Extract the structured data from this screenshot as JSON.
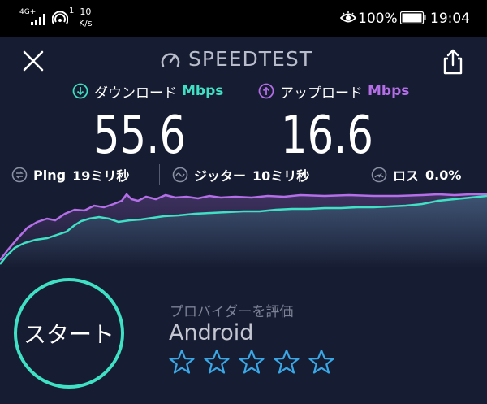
{
  "status_bar": {
    "network": "4G+",
    "wifi_count": "1",
    "speed_value": "10",
    "speed_unit": "K/s",
    "battery": "100%",
    "time": "19:04"
  },
  "header": {
    "title": "SPEEDTEST"
  },
  "download": {
    "label": "ダウンロード",
    "unit": "Mbps",
    "value": "55.6",
    "color": "#3fe0c4"
  },
  "upload": {
    "label": "アップロード",
    "unit": "Mbps",
    "value": "16.6",
    "color": "#b46ee8"
  },
  "ping": {
    "label": "Ping",
    "value": "19ミリ秒"
  },
  "jitter": {
    "label": "ジッター",
    "value": "10ミリ秒"
  },
  "loss": {
    "label": "ロス",
    "value": "0.0%"
  },
  "start_button": {
    "label": "スタート"
  },
  "provider": {
    "hint": "プロバイダーを評価",
    "name": "Android",
    "rating_max": 5,
    "rating": 0
  },
  "colors": {
    "background": "#161c31",
    "accent_download": "#3fe0c4",
    "accent_upload": "#b46ee8",
    "star": "#3aa7e6"
  }
}
